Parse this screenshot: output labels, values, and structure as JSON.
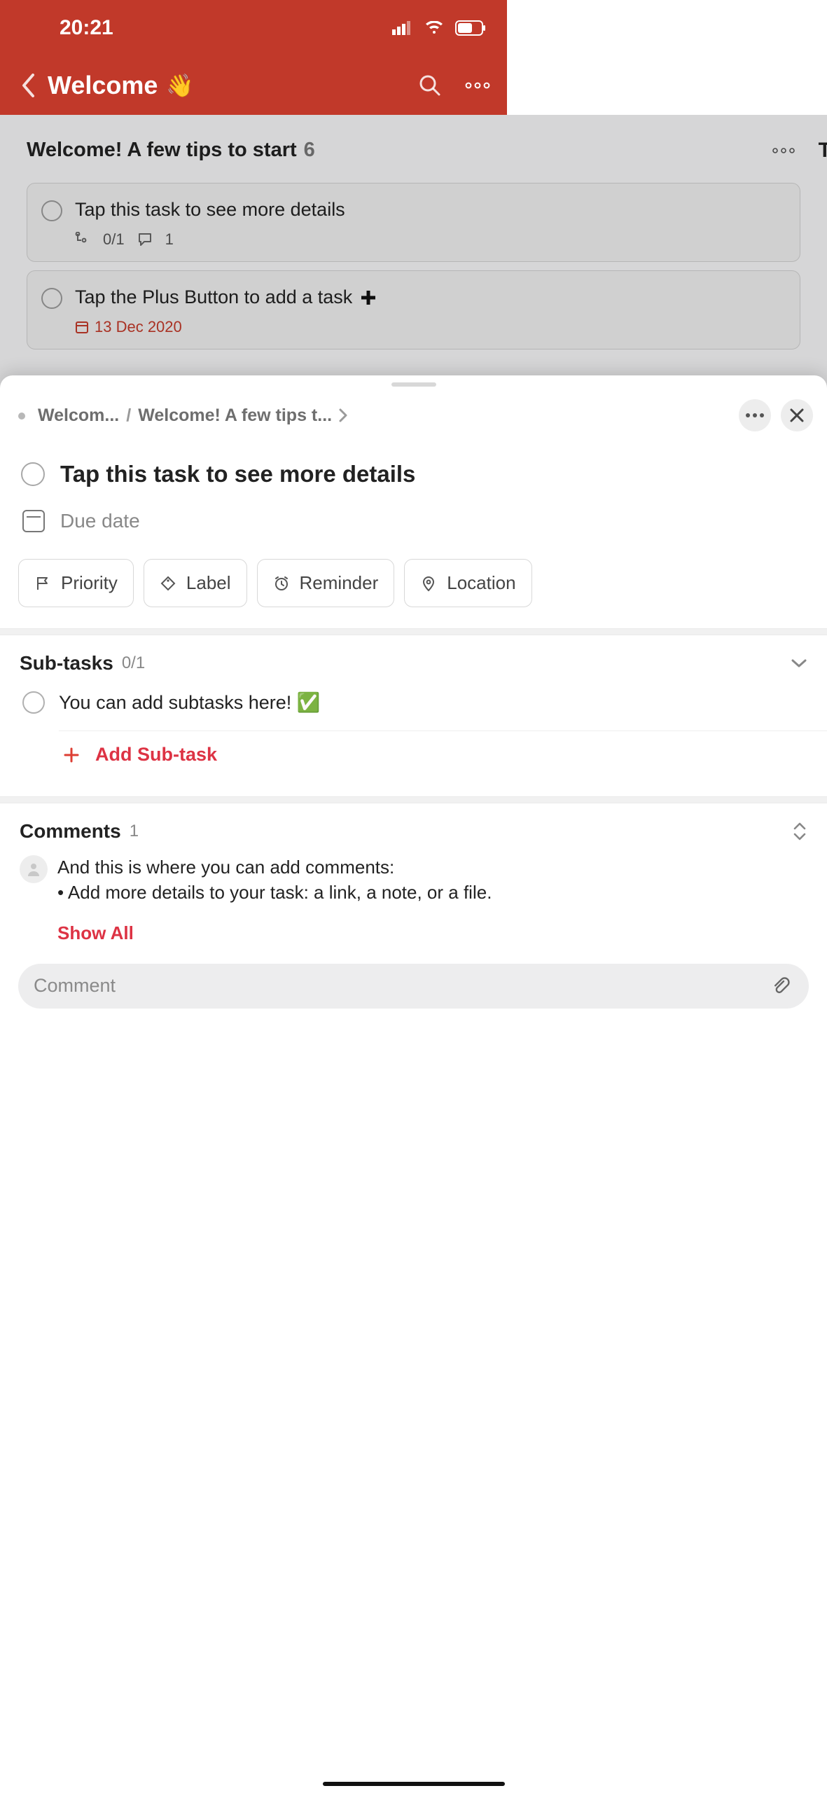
{
  "statusbar": {
    "time": "20:21"
  },
  "header": {
    "title": "Welcome",
    "emoji": "👋"
  },
  "bg": {
    "section_title": "Welcome! A few tips to start",
    "section_count": "6",
    "next_tab_hint": "T",
    "task1": {
      "title": "Tap this task to see more details",
      "subtasks_badge": "0/1",
      "comments_badge": "1"
    },
    "task2": {
      "title": "Tap the Plus Button to add a task",
      "plus": "➕",
      "due": "13 Dec 2020"
    }
  },
  "sheet": {
    "breadcrumb": {
      "project": "Welcom...",
      "section": "Welcome! A few tips t..."
    },
    "task_title": "Tap this task to see more details",
    "due_placeholder": "Due date",
    "chips": {
      "priority": "Priority",
      "label": "Label",
      "reminder": "Reminder",
      "location": "Location"
    },
    "subtasks": {
      "title": "Sub-tasks",
      "count": "0/1",
      "item1": "You can add subtasks here! ✅",
      "add": "Add Sub-task"
    },
    "comments": {
      "title": "Comments",
      "count": "1",
      "body_line1": "And this is where you can add comments:",
      "body_line2": "• Add more details to your task: a link, a note, or a file.",
      "show_all": "Show All",
      "placeholder": "Comment"
    }
  }
}
